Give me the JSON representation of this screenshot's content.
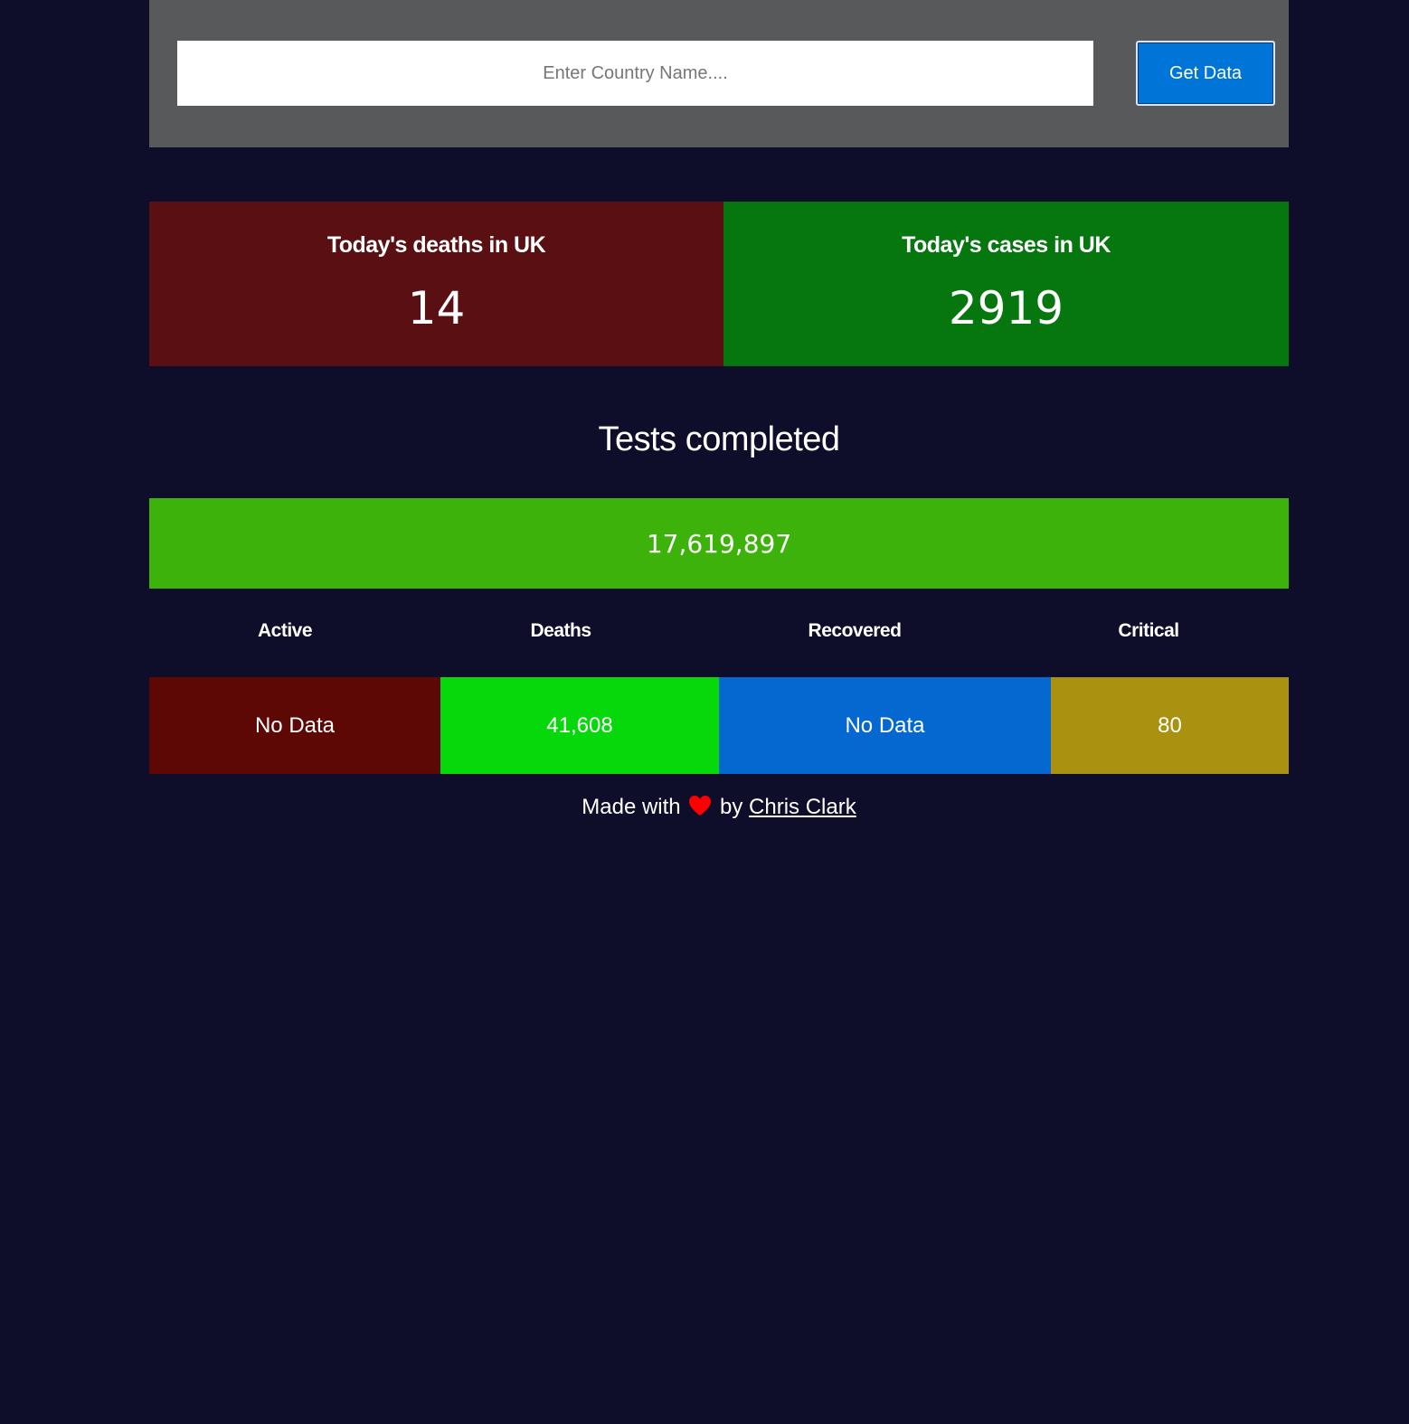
{
  "search": {
    "placeholder": "Enter Country Name....",
    "value": "",
    "button_label": "Get Data"
  },
  "today": {
    "deaths_label": "Today's deaths in UK",
    "deaths_value": "14",
    "cases_label": "Today's cases in UK",
    "cases_value": "2919"
  },
  "tests": {
    "title": "Tests completed",
    "value": "17,619,897"
  },
  "stats": {
    "headers": [
      "Active",
      "Deaths",
      "Recovered",
      "Critical"
    ],
    "values": [
      "No Data",
      "41,608",
      "No Data",
      "80"
    ]
  },
  "footer": {
    "prefix": "Made with",
    "by": "by",
    "author": "Chris Clark",
    "icon": "heart-icon"
  },
  "colors": {
    "background": "#0e0e2b",
    "search_panel": "#58595b",
    "button": "#0075d8",
    "today_deaths": "#5a1013",
    "today_cases": "#06760f",
    "tests": "#3cb20b",
    "active": "#5e0806",
    "deaths": "#06d80b",
    "recovered": "#0568d0",
    "critical": "#aa9110",
    "heart": "#ff0000"
  }
}
